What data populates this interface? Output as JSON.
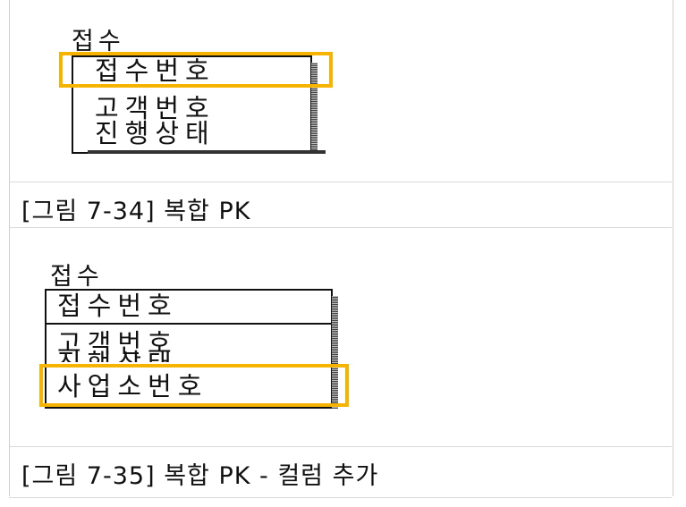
{
  "figure1": {
    "entity_name": "접수",
    "attributes": [
      "접수번호",
      "고객번호",
      "진행상태"
    ],
    "caption": "[그림 7-34] 복합 PK"
  },
  "figure2": {
    "entity_name": "접수",
    "attributes": [
      "접수번호",
      "고객번호",
      "진행상태",
      "사업소번호"
    ],
    "caption": "[그림 7-35] 복합 PK - 컬럼 추가"
  },
  "colors": {
    "highlight": "#f6b400",
    "border": "#111111"
  }
}
